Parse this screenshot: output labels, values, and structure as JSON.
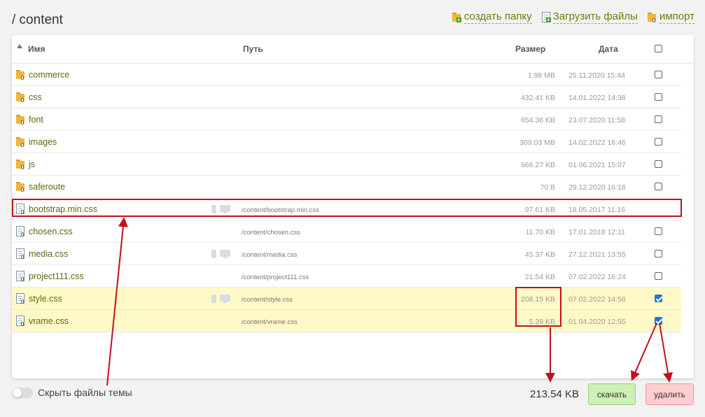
{
  "breadcrumb": "/ content",
  "toolbar": {
    "create_folder": "создать папку",
    "upload_files": "Загрузить файлы",
    "import": "импорт"
  },
  "table": {
    "columns": {
      "name": "Имя",
      "path": "Путь",
      "size": "Размер",
      "date": "Дата"
    },
    "rows": [
      {
        "type": "folder",
        "name": "commerce",
        "path": "",
        "size": "1.98 MB",
        "date": "25.11.2020 15:44",
        "devices": false,
        "checked": false,
        "checkbox": true
      },
      {
        "type": "folder",
        "name": "css",
        "path": "",
        "size": "432.41 KB",
        "date": "14.01.2022 14:38",
        "devices": false,
        "checked": false,
        "checkbox": true
      },
      {
        "type": "folder",
        "name": "font",
        "path": "",
        "size": "654.36 KB",
        "date": "23.07.2020 11:58",
        "devices": false,
        "checked": false,
        "checkbox": true
      },
      {
        "type": "folder",
        "name": "images",
        "path": "",
        "size": "309.03 MB",
        "date": "14.02.2022 16:46",
        "devices": false,
        "checked": false,
        "checkbox": true
      },
      {
        "type": "folder",
        "name": "js",
        "path": "",
        "size": "666.27 KB",
        "date": "01.06.2021 15:07",
        "devices": false,
        "checked": false,
        "checkbox": true
      },
      {
        "type": "folder",
        "name": "saferoute",
        "path": "",
        "size": "70 B",
        "date": "29.12.2020 16:16",
        "devices": false,
        "checked": false,
        "checkbox": true
      },
      {
        "type": "file",
        "name": "bootstrap.min.css",
        "path": "/content/bootstrap.min.css",
        "size": "97.61 KB",
        "date": "18.05.2017 11:16",
        "devices": true,
        "checked": false,
        "checkbox": false
      },
      {
        "type": "file",
        "name": "chosen.css",
        "path": "/content/chosen.css",
        "size": "11.70 KB",
        "date": "17.01.2018 12:11",
        "devices": false,
        "checked": false,
        "checkbox": true
      },
      {
        "type": "file",
        "name": "media.css",
        "path": "/content/media.css",
        "size": "45.37 KB",
        "date": "27.12.2021 13:55",
        "devices": true,
        "checked": false,
        "checkbox": true
      },
      {
        "type": "file",
        "name": "project111.css",
        "path": "/content/project111.css",
        "size": "21.54 KB",
        "date": "07.02.2022 16:24",
        "devices": false,
        "checked": false,
        "checkbox": true
      },
      {
        "type": "file",
        "name": "style.css",
        "path": "/content/style.css",
        "size": "208.15 KB",
        "date": "07.02.2022 14:56",
        "devices": true,
        "checked": true,
        "checkbox": true
      },
      {
        "type": "file",
        "name": "vrame.css",
        "path": "/content/vrame.css",
        "size": "5.39 KB",
        "date": "01.04.2020 12:55",
        "devices": false,
        "checked": true,
        "checkbox": true
      }
    ]
  },
  "footer": {
    "hide_theme_files": "Скрыть файлы темы",
    "total_size": "213.54 KB",
    "download": "скачать",
    "delete": "удалить"
  },
  "colors": {
    "link": "#5a6b12",
    "selected_row": "#fff9c8",
    "annotation": "#c0101e",
    "download_bg": "#ccf0b5",
    "delete_bg": "#ffcfcf"
  }
}
